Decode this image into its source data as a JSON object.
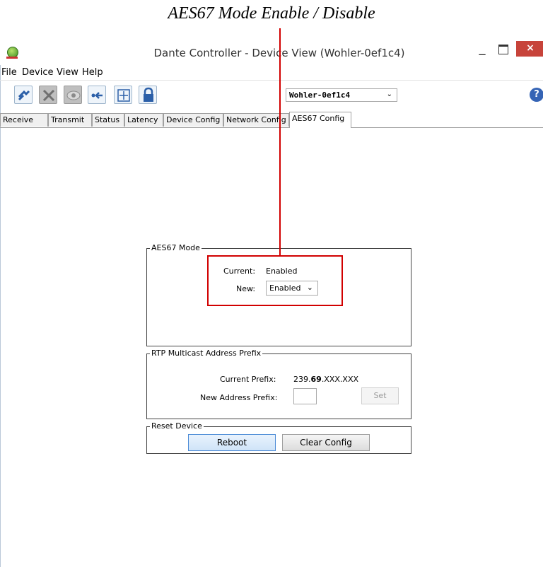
{
  "annotation": {
    "title": "AES67 Mode Enable / Disable",
    "color": "#d10000"
  },
  "window": {
    "title": "Dante Controller - Device View (Wohler-0ef1c4)",
    "min_glyph": "_",
    "close_glyph": "×",
    "close_color": "#c7433a"
  },
  "menu": [
    "File",
    "Device",
    "View",
    "Help"
  ],
  "toolbar": {
    "buttons": [
      "refresh-icon",
      "network-icon",
      "eye-icon",
      "connect-icon",
      "add-icon",
      "lock-icon"
    ],
    "device_select": "Wohler-0ef1c4",
    "help_glyph": "?"
  },
  "tabs": [
    "Receive",
    "Transmit",
    "Status",
    "Latency",
    "Device Config",
    "Network Config",
    "AES67 Config"
  ],
  "active_tab": "AES67 Config",
  "aes67_mode": {
    "legend": "AES67 Mode",
    "current_label": "Current:",
    "current_value": "Enabled",
    "new_label": "New:",
    "new_value": "Enabled"
  },
  "rtp_prefix": {
    "legend": "RTP Multicast Address Prefix",
    "current_label": "Current Prefix:",
    "current_value_pre": "239.",
    "current_value_bold": "69",
    "current_value_post": ".XXX.XXX",
    "new_label": "New Address Prefix:",
    "new_value": "",
    "set_label": "Set"
  },
  "reset_device": {
    "legend": "Reset Device",
    "reboot_label": "Reboot",
    "clear_label": "Clear Config"
  }
}
